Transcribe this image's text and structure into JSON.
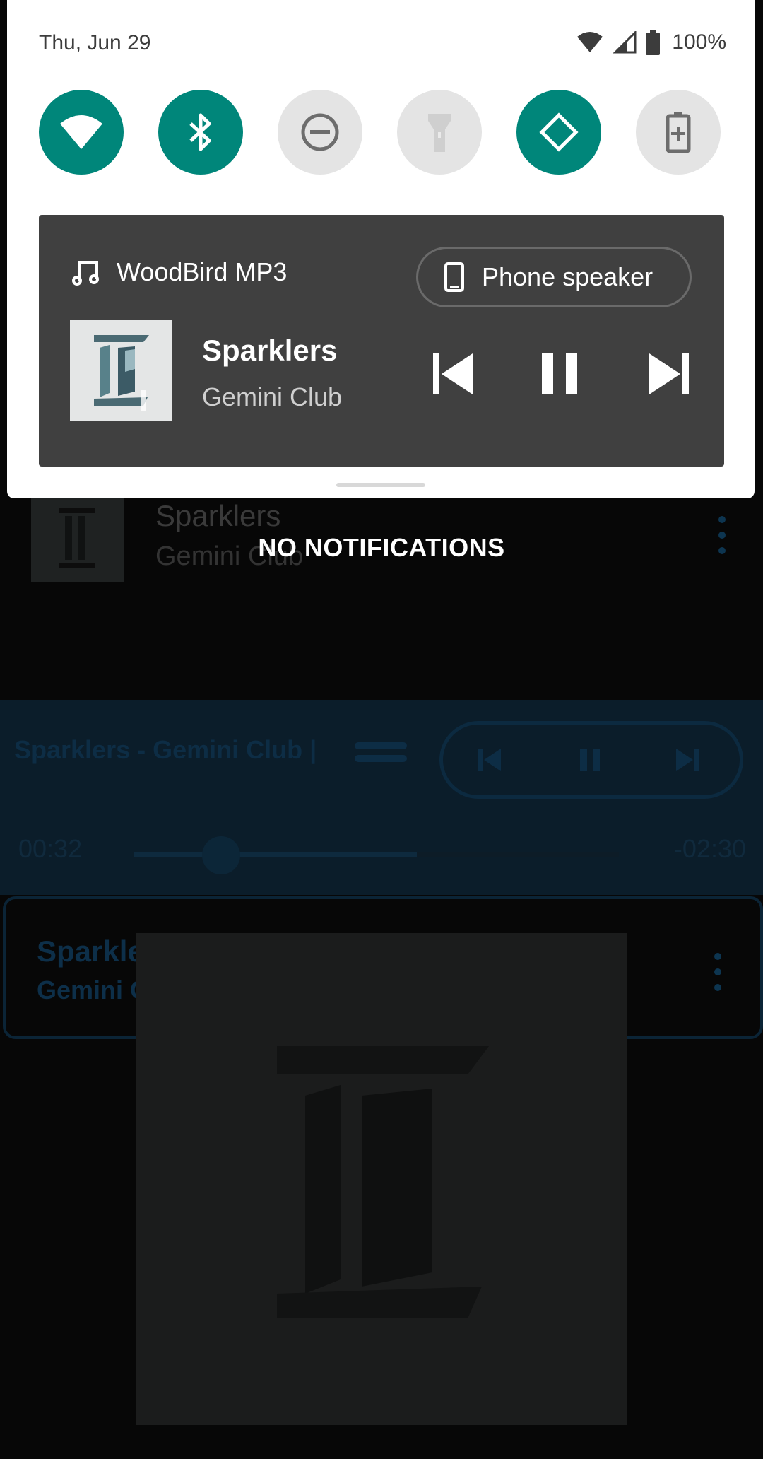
{
  "status_bar": {
    "date": "Thu, Jun 29",
    "battery_pct": "100%"
  },
  "quick_tiles": [
    {
      "name": "wifi",
      "state": "on",
      "icon": "wifi-icon"
    },
    {
      "name": "bluetooth",
      "state": "on",
      "icon": "bluetooth-icon"
    },
    {
      "name": "do-not-disturb",
      "state": "off",
      "icon": "dnd-icon"
    },
    {
      "name": "flashlight",
      "state": "off",
      "icon": "flashlight-icon"
    },
    {
      "name": "auto-rotate",
      "state": "on",
      "icon": "rotate-icon"
    },
    {
      "name": "battery-saver",
      "state": "off",
      "icon": "battery-saver-icon"
    }
  ],
  "media_notification": {
    "app_name": "WoodBird MP3",
    "output_device": "Phone speaker",
    "song_title": "Sparklers",
    "artist": "Gemini Club"
  },
  "shade": {
    "empty_message": "NO NOTIFICATIONS"
  },
  "background_app": {
    "list_item": {
      "title": "Sparklers",
      "artist": "Gemini Club"
    },
    "player": {
      "marquee": "Sparklers - Gemini Club |",
      "elapsed": "00:32",
      "remaining": "-02:30",
      "progress_fraction": 0.18
    },
    "now_playing": {
      "title": "Sparklers",
      "artist": "Gemini Club"
    }
  },
  "colors": {
    "tile_on": "#00867a",
    "tile_off": "#e4e4e4",
    "media_bg": "#404040"
  }
}
